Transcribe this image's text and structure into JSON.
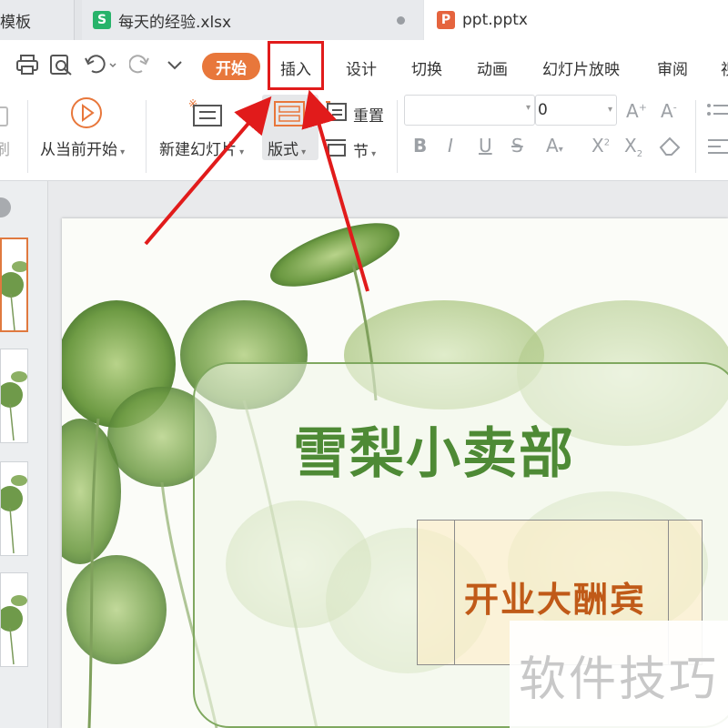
{
  "tabs": [
    {
      "label": "模板"
    },
    {
      "label": "每天的经验.xlsx",
      "icon": "S"
    },
    {
      "label": "ppt.pptx",
      "icon": "P"
    }
  ],
  "menu": {
    "start": "开始",
    "insert": "插入",
    "design": "设计",
    "transition": "切换",
    "animation": "动画",
    "slideshow": "幻灯片放映",
    "review": "审阅",
    "view_partial": "视"
  },
  "ribbon": {
    "brush_partial": "刷",
    "play_from_current": "从当前开始",
    "new_slide": "新建幻灯片",
    "layout": "版式",
    "reset": "重置",
    "section": "节",
    "font_size": "0"
  },
  "slide": {
    "title": "雪梨小卖部",
    "subtitle": "开业大酬宾"
  },
  "watermark": "软件技巧",
  "colors": {
    "accent_orange": "#e8773b",
    "highlight_red": "#e11b1b",
    "title_green": "#4e8a35",
    "subtitle_orange": "#c05a18"
  }
}
